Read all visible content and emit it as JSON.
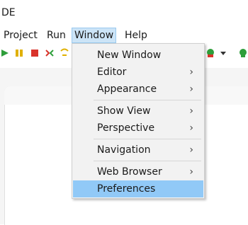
{
  "window": {
    "title": "DE"
  },
  "menubar": {
    "items": [
      {
        "label": "Project"
      },
      {
        "label": "Run"
      },
      {
        "label": "Window"
      },
      {
        "label": "Help"
      }
    ]
  },
  "toolbar": {
    "icons": [
      "run-icon",
      "suspend-icon",
      "terminate-icon",
      "disconnect-icon",
      "step-icon",
      "new-java-class-icon",
      "dropdown-arrow-icon",
      "new-package-icon"
    ]
  },
  "window_menu": {
    "items": [
      {
        "label": "New Window",
        "submenu": false
      },
      {
        "label": "Editor",
        "submenu": true
      },
      {
        "label": "Appearance",
        "submenu": true
      },
      {
        "label": "Show View",
        "submenu": true
      },
      {
        "label": "Perspective",
        "submenu": true
      },
      {
        "label": "Navigation",
        "submenu": true
      },
      {
        "label": "Web Browser",
        "submenu": true
      },
      {
        "label": "Preferences",
        "submenu": false,
        "highlighted": true
      }
    ],
    "submenu_glyph": "›"
  },
  "colors": {
    "highlight": "#91c9f7",
    "menu_bg": "#f2f2f2",
    "active_menu_bg": "#cce4f7"
  }
}
